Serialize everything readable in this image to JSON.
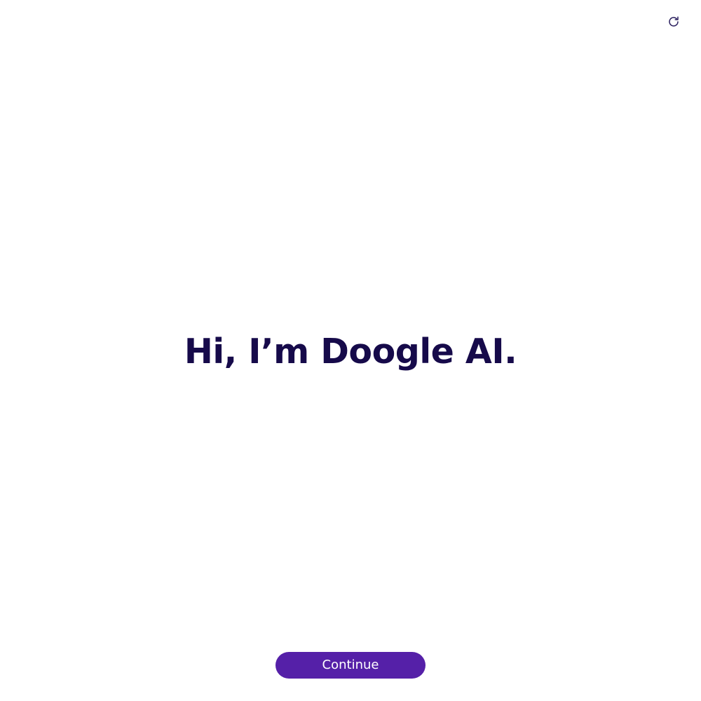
{
  "header": {
    "refresh_icon": "refresh-icon"
  },
  "main": {
    "greeting": "Hi, I’m Doogle AI."
  },
  "footer": {
    "continue_label": "Continue"
  },
  "colors": {
    "title": "#160a4a",
    "button_bg": "#5520a8",
    "button_text": "#ffffff",
    "icon": "#2a1f5e",
    "background": "#ffffff"
  }
}
